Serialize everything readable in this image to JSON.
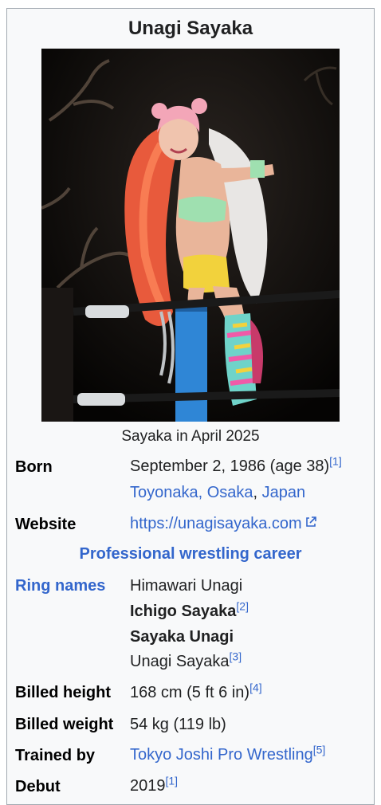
{
  "infobox": {
    "title": "Unagi Sayaka",
    "image_caption": "Sayaka in April 2025",
    "born": {
      "label": "Born",
      "date": "September 2, 1986 (age 38)",
      "date_ref": "[1]",
      "place": [
        "Toyonaka, Osaka",
        "Japan"
      ],
      "place_sep": ", "
    },
    "website": {
      "label": "Website",
      "url": "https://unagisayaka.com"
    },
    "section_title": "Professional wrestling career",
    "ring_names": {
      "label": "Ring names",
      "names": [
        {
          "text": "Himawari Unagi",
          "ref": ""
        },
        {
          "text": "Ichigo Sayaka",
          "ref": "[2]"
        },
        {
          "text": "Sayaka Unagi",
          "ref": ""
        },
        {
          "text": "Unagi Sayaka",
          "ref": "[3]"
        }
      ]
    },
    "billed_height": {
      "label": "Billed height",
      "value": "168 cm (5 ft 6 in)",
      "ref": "[4]"
    },
    "billed_weight": {
      "label": "Billed weight",
      "value": "54 kg (119 lb)"
    },
    "trained_by": {
      "label": "Trained by",
      "value": "Tokyo Joshi Pro Wrestling",
      "ref": "[5]"
    },
    "debut": {
      "label": "Debut",
      "value": "2019",
      "ref": "[1]"
    }
  }
}
